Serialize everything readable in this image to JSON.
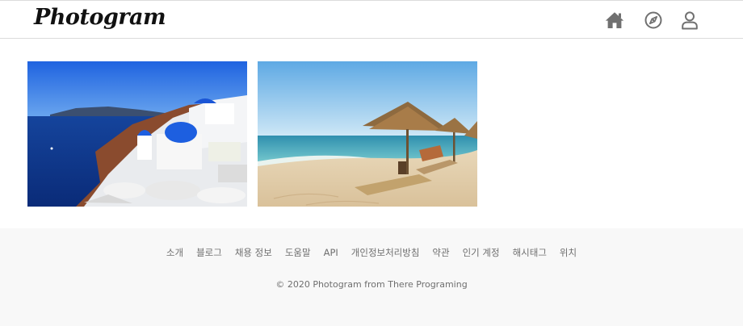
{
  "header": {
    "logo_text": "Photogram",
    "nav": [
      {
        "icon": "home-icon"
      },
      {
        "icon": "compass-icon"
      },
      {
        "icon": "user-icon"
      }
    ]
  },
  "feed": {
    "posts": [
      {
        "image": "santorini-photo"
      },
      {
        "image": "beach-umbrellas-photo"
      }
    ]
  },
  "footer": {
    "links": [
      "소개",
      "블로그",
      "채용 정보",
      "도움말",
      "API",
      "개인정보처리방침",
      "약관",
      "인기 계정",
      "해시태그",
      "위치"
    ],
    "copyright": "© 2020 Photogram from There Programing"
  },
  "colors": {
    "header_border": "#dbdbdb",
    "footer_bg": "#f8f8f8",
    "icon": "#707070",
    "footer_text": "#6f6f6f"
  }
}
